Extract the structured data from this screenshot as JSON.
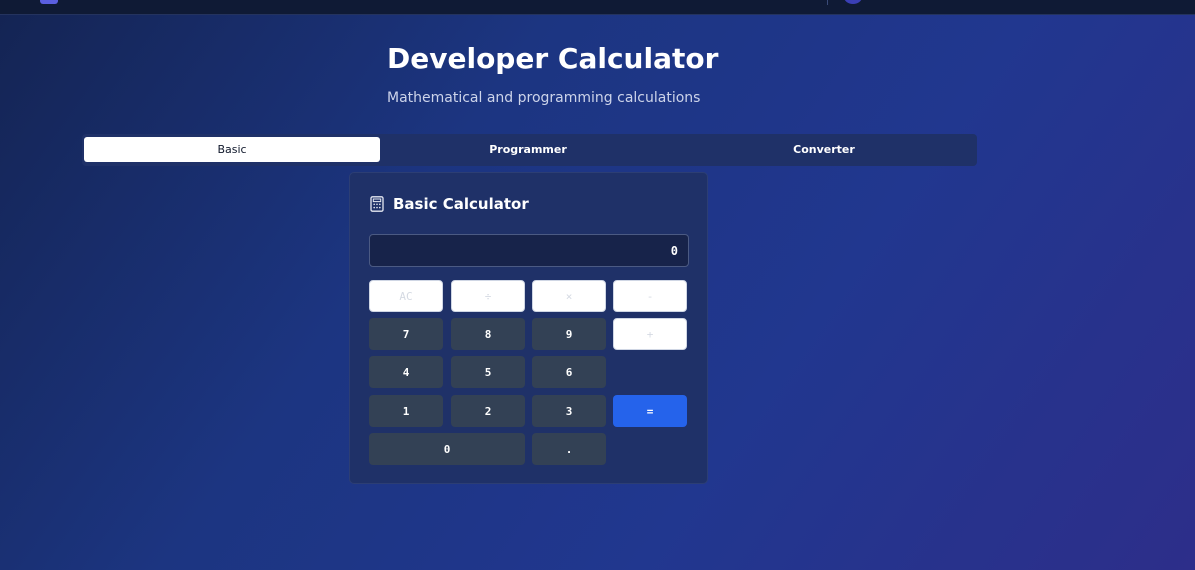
{
  "header": {
    "title": "Developer Calculator",
    "subtitle": "Mathematical and programming calculations"
  },
  "tabs": [
    {
      "label": "Basic",
      "active": true
    },
    {
      "label": "Programmer",
      "active": false
    },
    {
      "label": "Converter",
      "active": false
    }
  ],
  "calculator": {
    "title": "Basic Calculator",
    "icon": "calculator-icon",
    "display_value": "0",
    "keys": {
      "clear": "AC",
      "divide": "÷",
      "multiply": "×",
      "subtract": "-",
      "add": "+",
      "equals": "=",
      "decimal": ".",
      "d0": "0",
      "d1": "1",
      "d2": "2",
      "d3": "3",
      "d4": "4",
      "d5": "5",
      "d6": "6",
      "d7": "7",
      "d8": "8",
      "d9": "9"
    }
  },
  "colors": {
    "accent": "#2563eb",
    "card_bg": "#1f3168",
    "number_key_bg": "#334155",
    "operator_key_bg": "#ffffff"
  }
}
